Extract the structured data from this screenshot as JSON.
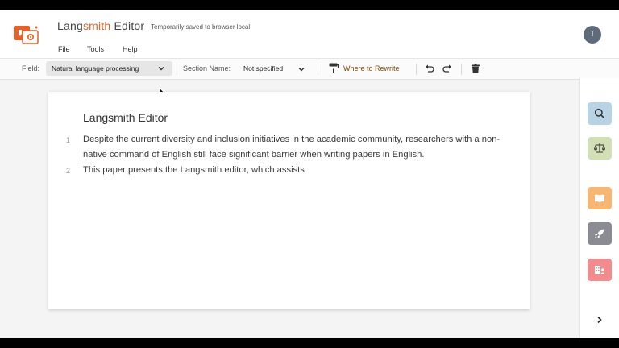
{
  "header": {
    "title_part1": "Lang",
    "title_part2": "smith",
    "title_part3": " Editor",
    "save_status": "Temporarily saved to browser local",
    "menus": [
      "File",
      "Tools",
      "Help"
    ],
    "avatar_initial": "T"
  },
  "toolbar": {
    "field_label": "Field:",
    "field_value": "Natural language processing",
    "section_label": "Section Name:",
    "section_value": "Not specified",
    "rewrite_label": "Where to Rewrite"
  },
  "editor": {
    "title": "Langsmith Editor",
    "lines": [
      {
        "num": "1",
        "text": "Despite the current diversity and inclusion initiatives in the academic community, researchers with a non-native command of English still face significant barrier when writing papers in English."
      },
      {
        "num": "2",
        "text": "This paper presents the Langsmith editor, which assists"
      }
    ]
  },
  "sidebar": {
    "buttons": [
      {
        "name": "search-icon",
        "color": "#b9d3e6"
      },
      {
        "name": "balance-icon",
        "color": "#d3e0b5"
      },
      {
        "name": "book-icon",
        "color": "#f7b774"
      },
      {
        "name": "rocket-icon",
        "color": "#8b8b93"
      },
      {
        "name": "document-icon",
        "color": "#f28b8e"
      }
    ]
  },
  "colors": {
    "accent": "#e2622a",
    "rewrite_text": "#7a4a0c"
  }
}
